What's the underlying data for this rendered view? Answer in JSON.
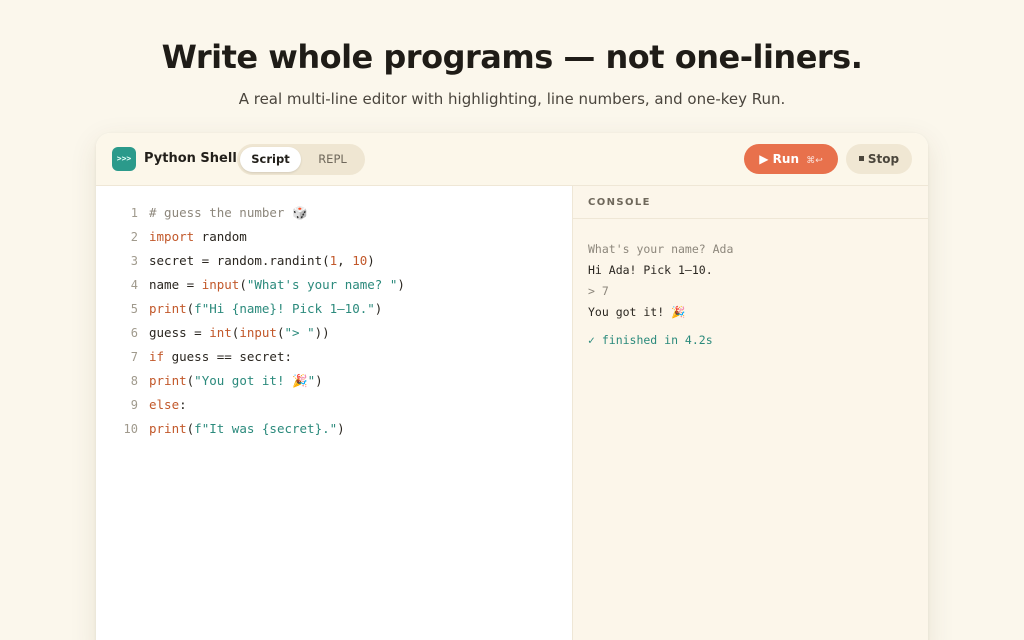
{
  "hero": {
    "title": "Write whole programs — not one-liners.",
    "subtitle": "A real multi-line editor with highlighting, line numbers, and one-key Run."
  },
  "toolbar": {
    "logo_text": ">>>",
    "app_name": "Python Shell",
    "modes": [
      "Script",
      "REPL"
    ],
    "active_mode": "Script",
    "run_label": "Run",
    "run_shortcut": "⌘↩",
    "stop_label": "Stop"
  },
  "editor": {
    "lines": [
      {
        "n": "1",
        "segments": [
          {
            "t": "# guess the number 🎲",
            "c": "comment"
          }
        ]
      },
      {
        "n": "2",
        "segments": [
          {
            "t": "import",
            "c": "kw"
          },
          {
            "t": " random",
            "c": ""
          }
        ]
      },
      {
        "n": "3",
        "segments": [
          {
            "t": "secret = random.randint(",
            "c": ""
          },
          {
            "t": "1",
            "c": "num"
          },
          {
            "t": ", ",
            "c": ""
          },
          {
            "t": "10",
            "c": "num"
          },
          {
            "t": ")",
            "c": ""
          }
        ]
      },
      {
        "n": "4",
        "segments": [
          {
            "t": "name = ",
            "c": ""
          },
          {
            "t": "input",
            "c": "fn"
          },
          {
            "t": "(",
            "c": ""
          },
          {
            "t": "\"What's your name? \"",
            "c": "str"
          },
          {
            "t": ")",
            "c": ""
          }
        ]
      },
      {
        "n": "5",
        "segments": [
          {
            "t": "print",
            "c": "fn"
          },
          {
            "t": "(",
            "c": ""
          },
          {
            "t": "f\"Hi {name}! Pick 1–10.\"",
            "c": "str"
          },
          {
            "t": ")",
            "c": ""
          }
        ]
      },
      {
        "n": "6",
        "segments": [
          {
            "t": "guess = ",
            "c": ""
          },
          {
            "t": "int",
            "c": "fn"
          },
          {
            "t": "(",
            "c": ""
          },
          {
            "t": "input",
            "c": "fn"
          },
          {
            "t": "(",
            "c": ""
          },
          {
            "t": "\"> \"",
            "c": "str"
          },
          {
            "t": "))",
            "c": ""
          }
        ]
      },
      {
        "n": "7",
        "segments": [
          {
            "t": "if",
            "c": "kw"
          },
          {
            "t": " guess == secret:",
            "c": ""
          }
        ]
      },
      {
        "n": "8",
        "segments": [
          {
            "t": "print",
            "c": "fn"
          },
          {
            "t": "(",
            "c": ""
          },
          {
            "t": "\"You got it! 🎉\"",
            "c": "str"
          },
          {
            "t": ")",
            "c": ""
          }
        ]
      },
      {
        "n": "9",
        "segments": [
          {
            "t": "else",
            "c": "kw"
          },
          {
            "t": ":",
            "c": ""
          }
        ]
      },
      {
        "n": "10",
        "segments": [
          {
            "t": "print",
            "c": "fn"
          },
          {
            "t": "(",
            "c": ""
          },
          {
            "t": "f\"It was {secret}.\"",
            "c": "str"
          },
          {
            "t": ")",
            "c": ""
          }
        ]
      }
    ]
  },
  "console": {
    "header": "CONSOLE",
    "lines": [
      {
        "t": "What's your name? Ada",
        "c": "prompt"
      },
      {
        "t": "Hi Ada! Pick 1–10.",
        "c": "out"
      },
      {
        "t": "> 7",
        "c": "prompt"
      },
      {
        "t": "You got it! 🎉",
        "c": "out"
      },
      {
        "t": "✓ finished in 4.2s",
        "c": "done"
      }
    ]
  }
}
